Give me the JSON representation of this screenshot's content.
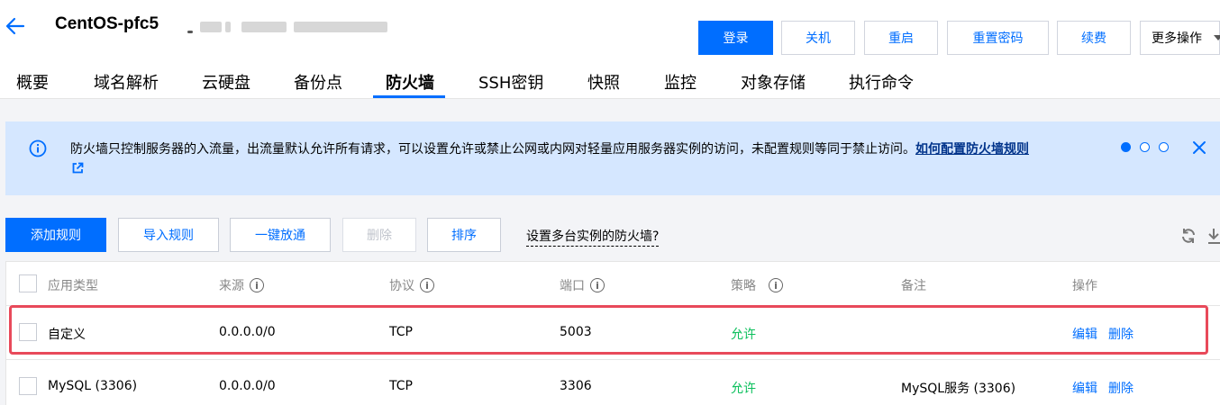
{
  "header": {
    "title": "CentOS-pfc5",
    "buttons": {
      "login": "登录",
      "shutdown": "关机",
      "restart": "重启",
      "reset_password": "重置密码",
      "renew": "续费",
      "more": "更多操作"
    }
  },
  "tabs": [
    "概要",
    "域名解析",
    "云硬盘",
    "备份点",
    "防火墙",
    "SSH密钥",
    "快照",
    "监控",
    "对象存储",
    "执行命令"
  ],
  "active_tab": "防火墙",
  "banner": {
    "text": "防火墙只控制服务器的入流量，出流量默认允许所有请求，可以设置允许或禁止公网或内网对轻量应用服务器实例的访问，未配置规则等同于禁止访问。",
    "link": "如何配置防火墙规则"
  },
  "toolbar": {
    "add_rule": "添加规则",
    "import_rules": "导入规则",
    "one_click_open": "一键放通",
    "delete": "删除",
    "sort": "排序",
    "multi_instance": "设置多台实例的防火墙?"
  },
  "table": {
    "columns": {
      "app_type": "应用类型",
      "source": "来源",
      "protocol": "协议",
      "port": "端口",
      "policy": "策略",
      "remark": "备注",
      "actions": "操作"
    },
    "rows": [
      {
        "app_type": "自定义",
        "source": "0.0.0.0/0",
        "protocol": "TCP",
        "port": "5003",
        "policy": "允许",
        "remark": "",
        "edit": "编辑",
        "delete": "删除"
      },
      {
        "app_type": "MySQL (3306)",
        "source": "0.0.0.0/0",
        "protocol": "TCP",
        "port": "3306",
        "policy": "允许",
        "remark": "MySQL服务 (3306)",
        "edit": "编辑",
        "delete": "删除"
      }
    ]
  },
  "colors": {
    "primary": "#006eff",
    "allow": "#0abf5b",
    "banner_bg": "#d5e7ff",
    "highlight": "#e8495a"
  }
}
